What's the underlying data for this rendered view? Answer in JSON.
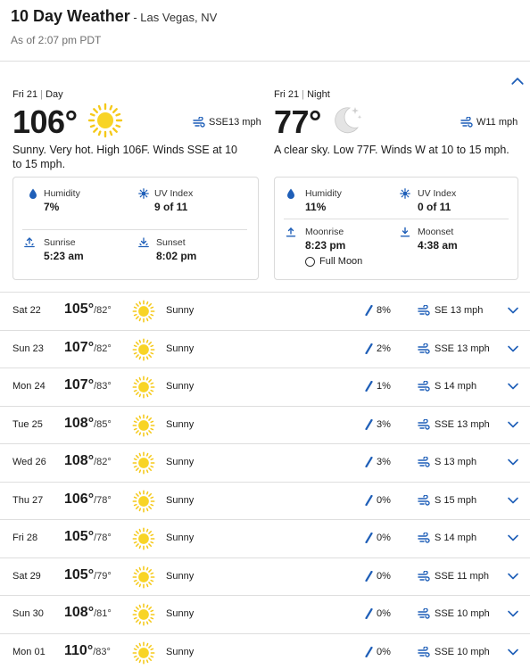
{
  "header": {
    "title": "10 Day Weather",
    "location": "Las Vegas, NV",
    "as_of": "As of 2:07 pm PDT"
  },
  "colors": {
    "accent_blue": "#1f5fb8",
    "sun_yellow": "#f5c91a",
    "text": "#1b1b1b",
    "divider": "#dedede"
  },
  "today": {
    "day_part": {
      "date": "Fri 21",
      "part": "Day",
      "temp": "106°",
      "icon": "sun-icon",
      "wind": "SSE13 mph",
      "description": "Sunny. Very hot. High 106F. Winds SSE at 10 to 15 mph.",
      "details": {
        "humidity_label": "Humidity",
        "humidity_value": "7%",
        "uv_label": "UV Index",
        "uv_value": "9 of 11",
        "sunrise_label": "Sunrise",
        "sunrise_value": "5:23 am",
        "sunset_label": "Sunset",
        "sunset_value": "8:02 pm"
      }
    },
    "night_part": {
      "date": "Fri 21",
      "part": "Night",
      "temp": "77°",
      "icon": "moon-icon",
      "wind": "W11 mph",
      "description": "A clear sky. Low 77F. Winds W at 10 to 15 mph.",
      "details": {
        "humidity_label": "Humidity",
        "humidity_value": "11%",
        "uv_label": "UV Index",
        "uv_value": "0 of 11",
        "moonrise_label": "Moonrise",
        "moonrise_value": "8:23 pm",
        "moonset_label": "Moonset",
        "moonset_value": "4:38 am",
        "moon_phase": "Full Moon"
      }
    }
  },
  "forecast": [
    {
      "day": "Sat 22",
      "hi": "105°",
      "lo": "/82°",
      "condition": "Sunny",
      "precip": "8%",
      "wind": "SE 13 mph"
    },
    {
      "day": "Sun 23",
      "hi": "107°",
      "lo": "/82°",
      "condition": "Sunny",
      "precip": "2%",
      "wind": "SSE 13 mph"
    },
    {
      "day": "Mon 24",
      "hi": "107°",
      "lo": "/83°",
      "condition": "Sunny",
      "precip": "1%",
      "wind": "S 14 mph"
    },
    {
      "day": "Tue 25",
      "hi": "108°",
      "lo": "/85°",
      "condition": "Sunny",
      "precip": "3%",
      "wind": "SSE 13 mph"
    },
    {
      "day": "Wed 26",
      "hi": "108°",
      "lo": "/82°",
      "condition": "Sunny",
      "precip": "3%",
      "wind": "S 13 mph"
    },
    {
      "day": "Thu 27",
      "hi": "106°",
      "lo": "/78°",
      "condition": "Sunny",
      "precip": "0%",
      "wind": "S 15 mph"
    },
    {
      "day": "Fri 28",
      "hi": "105°",
      "lo": "/78°",
      "condition": "Sunny",
      "precip": "0%",
      "wind": "S 14 mph"
    },
    {
      "day": "Sat 29",
      "hi": "105°",
      "lo": "/79°",
      "condition": "Sunny",
      "precip": "0%",
      "wind": "SSE 11 mph"
    },
    {
      "day": "Sun 30",
      "hi": "108°",
      "lo": "/81°",
      "condition": "Sunny",
      "precip": "0%",
      "wind": "SSE 10 mph"
    },
    {
      "day": "Mon 01",
      "hi": "110°",
      "lo": "/83°",
      "condition": "Sunny",
      "precip": "0%",
      "wind": "SSE 10 mph"
    }
  ]
}
